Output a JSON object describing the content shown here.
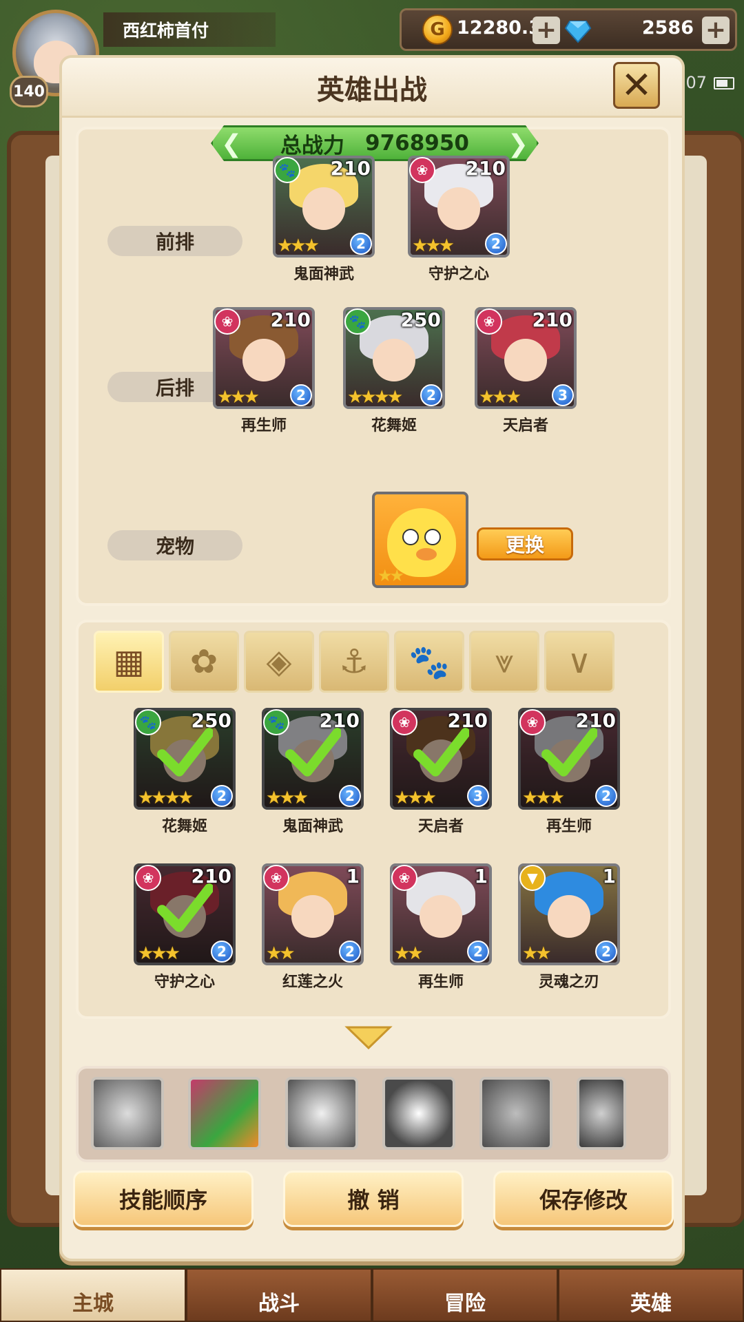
{
  "player": {
    "name": "西红柿首付",
    "level": "140"
  },
  "resources": {
    "gold": "12280.3K",
    "gems": "2586",
    "plus": "+"
  },
  "status": {
    "time_fragment": "07"
  },
  "dialog": {
    "title": "英雄出战",
    "close_label": "✕",
    "power_label": "总战力",
    "power_value": "9768950"
  },
  "lineup": {
    "front_label": "前排",
    "back_label": "后排",
    "pet_label": "宠物",
    "change_label": "更换",
    "front": [
      {
        "name": "鬼面神武",
        "level": "210",
        "rank": "2",
        "element": "beast",
        "stars": "★★★"
      },
      {
        "name": "守护之心",
        "level": "210",
        "rank": "2",
        "element": "lotus",
        "stars": "★★★"
      }
    ],
    "back": [
      {
        "name": "再生师",
        "level": "210",
        "rank": "2",
        "element": "lotus",
        "stars": "★★★"
      },
      {
        "name": "花舞姬",
        "level": "250",
        "rank": "2",
        "element": "beast",
        "stars": "★★★★"
      },
      {
        "name": "天启者",
        "level": "210",
        "rank": "3",
        "element": "lotus",
        "stars": "★★★"
      }
    ],
    "pet_stars": "★★"
  },
  "filters": [
    "all-icon",
    "lotus-icon",
    "diamond-icon",
    "anchor-icon",
    "beast-icon",
    "horn-icon",
    "wing-icon"
  ],
  "roster": [
    {
      "name": "花舞姬",
      "level": "250",
      "rank": "2",
      "element": "beast",
      "stars": "★★★★",
      "selected": true
    },
    {
      "name": "鬼面神武",
      "level": "210",
      "rank": "2",
      "element": "beast",
      "stars": "★★★",
      "selected": true
    },
    {
      "name": "天启者",
      "level": "210",
      "rank": "3",
      "element": "lotus",
      "stars": "★★★",
      "selected": true
    },
    {
      "name": "再生师",
      "level": "210",
      "rank": "2",
      "element": "lotus",
      "stars": "★★★",
      "selected": true
    },
    {
      "name": "守护之心",
      "level": "210",
      "rank": "2",
      "element": "lotus",
      "stars": "★★★",
      "selected": true
    },
    {
      "name": "红莲之火",
      "level": "1",
      "rank": "2",
      "element": "lotus",
      "stars": "★★",
      "selected": false
    },
    {
      "name": "再生师",
      "level": "1",
      "rank": "2",
      "element": "lotus",
      "stars": "★★",
      "selected": false
    },
    {
      "name": "灵魂之刃",
      "level": "1",
      "rank": "2",
      "element": "wing",
      "stars": "★★",
      "selected": false
    }
  ],
  "skills": [
    "heart-shield-icon",
    "flame-antler-icon",
    "winged-blade-icon",
    "vortex-icon",
    "crest-shield-icon",
    "orb-icon"
  ],
  "actions": {
    "skill_order": "技能顺序",
    "cancel": "撤 销",
    "save": "保存修改"
  },
  "nav": {
    "main_city": "主城",
    "battle": "战斗",
    "adventure": "冒险",
    "hero": "英雄"
  },
  "colors": {
    "lotus": "#d2345e",
    "beast": "#3aa640",
    "wing": "#e7b21c",
    "check": "#7bdc2c"
  }
}
